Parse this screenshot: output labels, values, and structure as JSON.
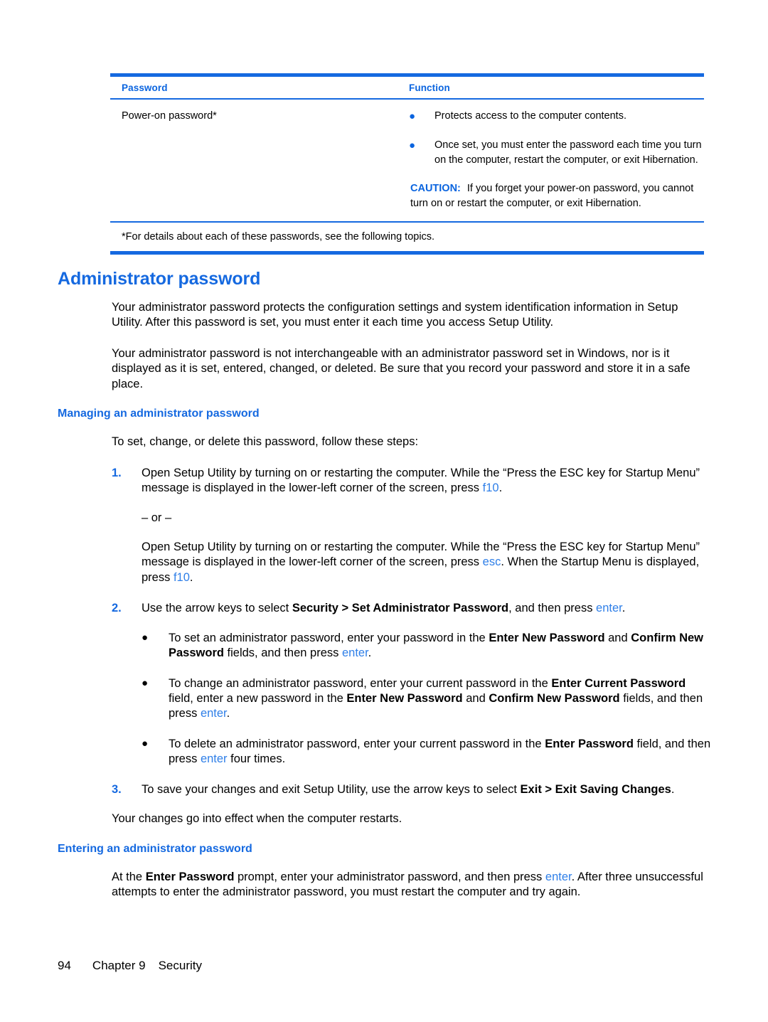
{
  "table": {
    "headers": [
      "Password",
      "Function"
    ],
    "row": {
      "password": "Power-on password*",
      "bullets": [
        "Protects access to the computer contents.",
        "Once set, you must enter the password each time you turn on the computer, restart the computer, or exit Hibernation."
      ],
      "caution_label": "CAUTION:",
      "caution_text": "If you forget your power-on password, you cannot turn on or restart the computer, or exit Hibernation."
    },
    "footnote": "*For details about each of these passwords, see the following topics."
  },
  "headings": {
    "main": "Administrator password",
    "managing": "Managing an administrator password",
    "entering": "Entering an administrator password"
  },
  "paragraphs": {
    "intro1": "Your administrator password protects the configuration settings and system identification information in Setup Utility. After this password is set, you must enter it each time you access Setup Utility.",
    "intro2": "Your administrator password is not interchangeable with an administrator password set in Windows, nor is it displayed as it is set, entered, changed, or deleted. Be sure that you record your password and store it in a safe place.",
    "steps_lead": "To set, change, or delete this password, follow these steps:",
    "effect": "Your changes go into effect when the computer restarts."
  },
  "steps": {
    "n1": "1.",
    "n2": "2.",
    "n3": "3.",
    "step1_a": "Open Setup Utility by turning on or restarting the computer. While the “Press the ESC key for Startup Menu” message is displayed in the lower-left corner of the screen, press ",
    "step1_key": "f10",
    "step1_end": ".",
    "or_label": "– or –",
    "alt_a": "Open Setup Utility by turning on or restarting the computer. While the “Press the ESC key for Startup Menu” message is displayed in the lower-left corner of the screen, press ",
    "alt_key1": "esc",
    "alt_b": ". When the Startup Menu is displayed, press ",
    "alt_key2": "f10",
    "alt_end": ".",
    "step2_a": "Use the arrow keys to select ",
    "step2_bold": "Security > Set Administrator Password",
    "step2_b": ", and then press ",
    "step2_key": "enter",
    "step2_end": ".",
    "step3_a": "To save your changes and exit Setup Utility, use the arrow keys to select ",
    "step3_bold": "Exit > Exit Saving Changes",
    "step3_end": "."
  },
  "bullets": {
    "set": {
      "a": "To set an administrator password, enter your password in the ",
      "b1": "Enter New Password",
      "c": " and ",
      "b2": "Confirm New Password",
      "d": " fields, and then press ",
      "key": "enter",
      "end": "."
    },
    "change": {
      "a": "To change an administrator password, enter your current password in the ",
      "b1": "Enter Current Password",
      "c": " field, enter a new password in the ",
      "b2": "Enter New Password",
      "d": " and ",
      "b3": "Confirm New Password",
      "e": " fields, and then press ",
      "key": "enter",
      "end": "."
    },
    "delete": {
      "a": "To delete an administrator password, enter your current password in the ",
      "b1": "Enter Password",
      "c": " field, and then press ",
      "key": "enter",
      "d": " four times."
    }
  },
  "entering_section": {
    "a": "At the ",
    "bold": "Enter Password",
    "b": " prompt, enter your administrator password, and then press ",
    "key": "enter",
    "c": ". After three unsuccessful attempts to enter the administrator password, you must restart the computer and try again."
  },
  "footer": {
    "page": "94",
    "chapter": "Chapter 9",
    "section": "Security"
  },
  "colors": {
    "accent_blue": "#1569e0",
    "heading_blue": "#0a64df",
    "key_blue": "#2f7fe8"
  }
}
